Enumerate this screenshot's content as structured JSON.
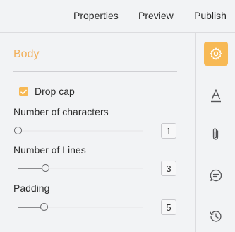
{
  "header": {
    "tabs": [
      {
        "label": "Properties"
      },
      {
        "label": "Preview"
      },
      {
        "label": "Publish"
      }
    ]
  },
  "panel": {
    "section_title": "Body",
    "drop_cap": {
      "label": "Drop cap",
      "checked": true
    },
    "fields": [
      {
        "label": "Number of characters",
        "value": "1",
        "slider_fraction": 0.0
      },
      {
        "label": "Number of Lines",
        "value": "3",
        "slider_fraction": 0.22
      },
      {
        "label": "Padding",
        "value": "5",
        "slider_fraction": 0.21
      }
    ]
  },
  "sidebar": {
    "items": [
      {
        "icon": "gear-icon",
        "active": true
      },
      {
        "icon": "text-format-icon",
        "active": false
      },
      {
        "icon": "paperclip-icon",
        "active": false
      },
      {
        "icon": "comment-icon",
        "active": false
      },
      {
        "icon": "history-icon",
        "active": false
      }
    ]
  },
  "colors": {
    "accent": "#f7b955",
    "section_title": "#f2b15c",
    "background": "#f2f3f5"
  }
}
